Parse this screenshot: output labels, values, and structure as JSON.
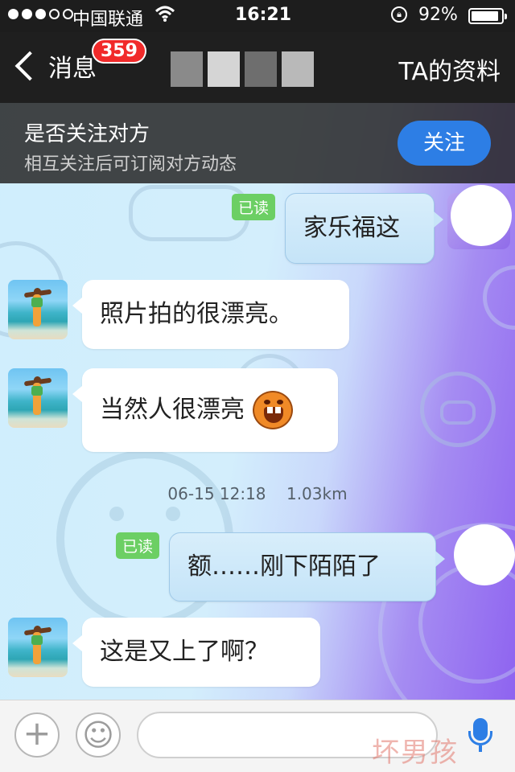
{
  "status_bar": {
    "carrier": "中国联通",
    "time": "16:21",
    "battery_percent": "92%",
    "battery_level": 0.92,
    "icons": [
      "signal-dots-icon",
      "wifi-icon",
      "rotation-lock-icon",
      "battery-icon"
    ]
  },
  "nav": {
    "back_label": "消息",
    "unread_badge": "359",
    "profile_link": "TA的资料"
  },
  "follow_banner": {
    "title": "是否关注对方",
    "subtitle": "相互关注后可订阅对方动态",
    "button": "关注"
  },
  "messages": [
    {
      "side": "right",
      "text": "家乐福这",
      "read_label": "已读"
    },
    {
      "side": "left",
      "text": "照片拍的很漂亮。"
    },
    {
      "side": "left",
      "text": "当然人很漂亮",
      "emoji": "laughing-emoji-icon"
    },
    {
      "side": "center",
      "timestamp": "06-15 12:18",
      "distance": "1.03km"
    },
    {
      "side": "right",
      "text": "额……刚下陌陌了",
      "read_label": "已读"
    },
    {
      "side": "left",
      "text": "这是又上了啊？"
    }
  ],
  "input_bar": {
    "icons": [
      "plus-icon",
      "smiley-icon",
      "microphone-icon"
    ],
    "text_value": ""
  },
  "watermark": "坏男孩",
  "colors": {
    "accent_blue": "#2d7ee5",
    "badge_red": "#f12a2a",
    "read_green": "#6ccf64",
    "nav_dark": "#1f1f1f"
  }
}
